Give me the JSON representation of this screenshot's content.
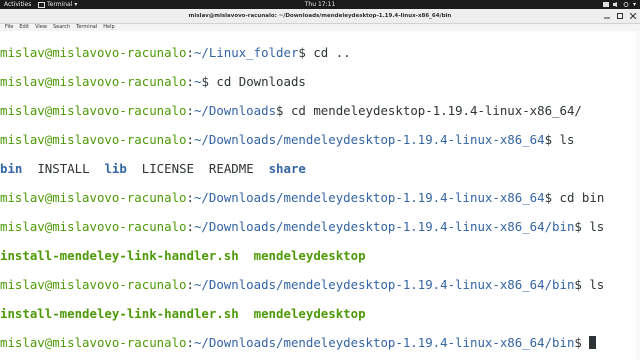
{
  "topbar": {
    "activities": "Activities",
    "app_name": "Terminal",
    "clock": "Thu 17:11"
  },
  "window": {
    "title": "mislav@mislavovo-racunalo: ~/Downloads/mendeleydesktop-1.19.4-linux-x86_64/bin"
  },
  "menu": [
    "File",
    "Edit",
    "View",
    "Search",
    "Terminal",
    "Help"
  ],
  "prompt": {
    "user": "mislav@mislavovo-racunalo",
    "sep": ":"
  },
  "lines": [
    {
      "path": "~/Linux_folder",
      "cmd": " cd .."
    },
    {
      "path": "~",
      "cmd": " cd Downloads"
    },
    {
      "path": "~/Downloads",
      "cmd": " cd mendeleydesktop-1.19.4-linux-x86_64/"
    },
    {
      "path": "~/Downloads/mendeleydesktop-1.19.4-linux-x86_64",
      "cmd": " ls"
    },
    {
      "path": "~/Downloads/mendeleydesktop-1.19.4-linux-x86_64",
      "cmd": " cd bin"
    },
    {
      "path": "~/Downloads/mendeleydesktop-1.19.4-linux-x86_64/bin",
      "cmd": " ls"
    },
    {
      "path": "~/Downloads/mendeleydesktop-1.19.4-linux-x86_64/bin",
      "cmd": " ls"
    },
    {
      "path": "~/Downloads/mendeleydesktop-1.19.4-linux-x86_64/bin",
      "cmd": " "
    }
  ],
  "ls_outputs": {
    "first": [
      "bin",
      "INSTALL",
      "lib",
      "LICENSE",
      "README",
      "share"
    ],
    "bin_first": [
      "install-mendeley-link-handler.sh",
      "mendeleydesktop"
    ],
    "bin_second": [
      "install-mendeley-link-handler.sh",
      "mendeleydesktop"
    ]
  },
  "colors": {
    "user": "#4e9a06",
    "path": "#3465a4",
    "text": "#2e3436"
  }
}
